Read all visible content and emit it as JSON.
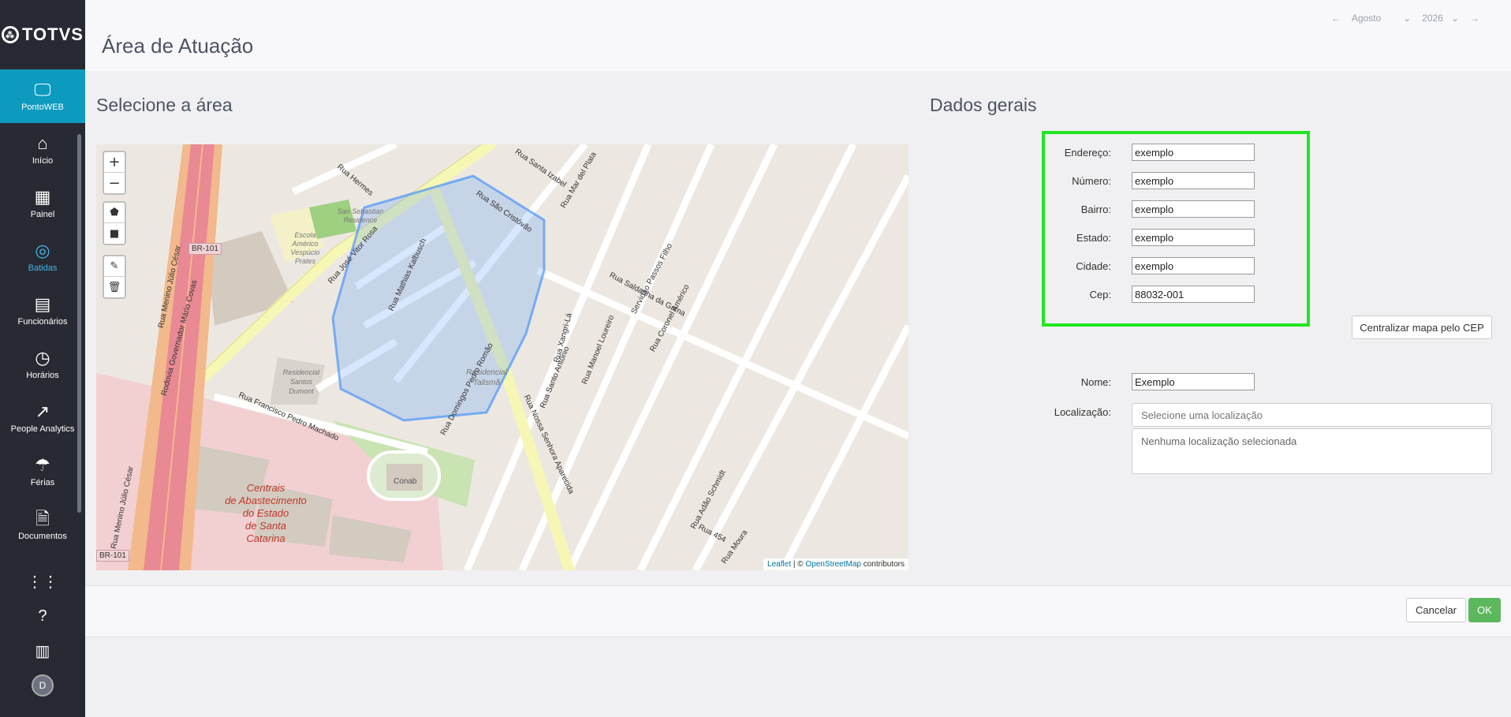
{
  "app": {
    "logo_text": "TOTVS"
  },
  "sidebar": {
    "items": [
      {
        "label": "PontoWEB",
        "icon": "monitor-icon"
      },
      {
        "label": "Início",
        "icon": "home-icon"
      },
      {
        "label": "Painel",
        "icon": "dashboard-icon"
      },
      {
        "label": "Batidas",
        "icon": "fingerprint-icon"
      },
      {
        "label": "Funcionários",
        "icon": "badge-icon"
      },
      {
        "label": "Horários",
        "icon": "clock-icon"
      },
      {
        "label": "People Analytics",
        "icon": "trending-icon"
      },
      {
        "label": "Férias",
        "icon": "beach-umbrella-icon"
      },
      {
        "label": "Documentos",
        "icon": "document-icon"
      }
    ],
    "avatar_initial": "D"
  },
  "header": {
    "title": "Área de Atuação",
    "month": "Agosto",
    "year": "2026"
  },
  "map_section": {
    "title": "Selecione a área",
    "attribution_leaflet": "Leaflet",
    "attribution_sep": " | © ",
    "attribution_osm": "OpenStreetMap",
    "attribution_suffix": " contributors",
    "labels": {
      "br101_a": "BR-101",
      "br101_b": "BR-101",
      "conab": "Conab",
      "centrais_1": "Centrais",
      "centrais_2": "de Abastecimento",
      "centrais_3": "do Estado",
      "centrais_4": "de Santa",
      "centrais_5": "Catarina",
      "residencial_santos": "Residencial",
      "residencial_santos_2": "Santos",
      "residencial_santos_3": "Dumont",
      "residencial_talisma": "Residencial",
      "residencial_talisma_2": "Talismã",
      "rua_francisco": "Rua Francisco Pedro Machado",
      "rua_saldanha": "Rua Saldanha da Gama",
      "rua_sao_cristovao": "Rua São Cristóvão",
      "rua_santa_izabel": "Rua Santa Izabel",
      "rua_mar_del_plata": "Rua Mar del Plata",
      "rua_hermes": "Rua Hermes",
      "rua_jose_vitor_rosa": "Rua José Vitor Rosa",
      "rua_mathias": "Rua Mathias Kalbusch",
      "rua_domingos": "Rua Domingos Pedro Romão",
      "rua_nossa_senhora": "Rua Nossa Senhora Aparecida",
      "rua_xangri": "Rua Xangri-Lá",
      "rua_santo_antonio": "Rua Santo Antônio",
      "rua_manoel_loureiro": "Rua Manoel Loureiro",
      "rua_coronel": "Rua Coronel Américo",
      "servidao_passos": "Servidão Passos Filho",
      "rua_adao": "Rua Adão Schmidt",
      "rua_454": "Rua 454",
      "rua_moura": "Rua Moura",
      "rod_governador": "Rodovia Governador Mário Covas",
      "rua_menino_1": "Rua Menino Júlio César",
      "rua_menino_2": "Rua Menino Júlio César",
      "escola_1": "Escola",
      "escola_2": "Américo",
      "escola_3": "Vespúcio",
      "escola_4": "Prates",
      "san_sebastian": "San Sebastian",
      "residence": "Residence"
    }
  },
  "form": {
    "title": "Dados gerais",
    "endereco_label": "Endereço:",
    "endereco_value": "exemplo",
    "numero_label": "Número:",
    "numero_value": "exemplo",
    "bairro_label": "Bairro:",
    "bairro_value": "exemplo",
    "estado_label": "Estado:",
    "estado_value": "exemplo",
    "cidade_label": "Cidade:",
    "cidade_value": "exemplo",
    "cep_label": "Cep:",
    "cep_value": "88032-001",
    "center_button": "Centralizar mapa pelo CEP",
    "nome_label": "Nome:",
    "nome_value": "Exemplo",
    "localizacao_label": "Localização:",
    "localizacao_placeholder": "Selecione uma localização",
    "localizacao_empty": "Nenhuma localização selecionada"
  },
  "footer": {
    "cancel": "Cancelar",
    "ok": "OK"
  },
  "colors": {
    "sidebar_bg": "#282a33",
    "active_nav": "#0c9abe",
    "highlight_border": "#22e522",
    "ok_button": "#5cb85c",
    "polygon": "#3388ff"
  }
}
